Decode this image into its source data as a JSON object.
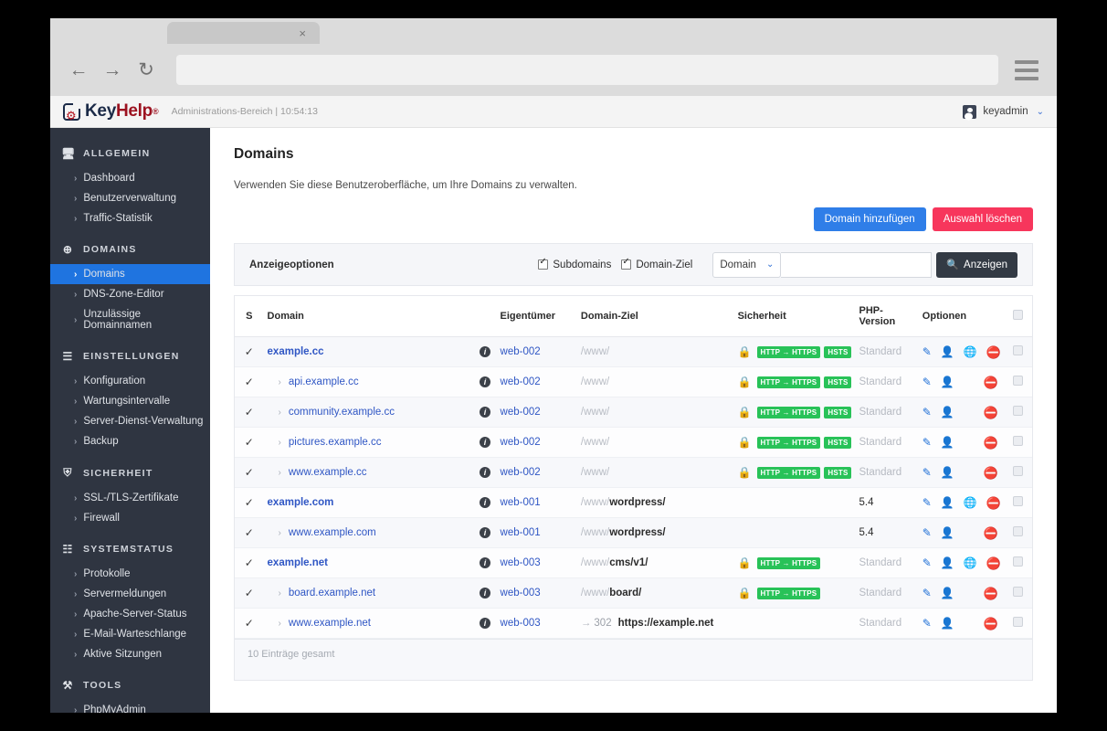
{
  "browser": {
    "tab_close": "×",
    "back_icon": "←",
    "forward_icon": "→",
    "reload_icon": "↻",
    "url_value": "",
    "url_placeholder": ""
  },
  "app_header": {
    "logo_key": "Key",
    "logo_help": "Help",
    "logo_reg": "®",
    "subtitle": "Administrations-Bereich | 10:54:13",
    "user_name": "keyadmin",
    "user_caret": "⌄"
  },
  "sidebar": {
    "groups": [
      {
        "title": "ALLGEMEIN",
        "icon": "🖥",
        "items": [
          {
            "label": "Dashboard",
            "active": false
          },
          {
            "label": "Benutzerverwaltung",
            "active": false
          },
          {
            "label": "Traffic-Statistik",
            "active": false
          }
        ]
      },
      {
        "title": "DOMAINS",
        "icon": "⊕",
        "items": [
          {
            "label": "Domains",
            "active": true
          },
          {
            "label": "DNS-Zone-Editor",
            "active": false
          },
          {
            "label": "Unzulässige Domainnamen",
            "active": false
          }
        ]
      },
      {
        "title": "EINSTELLUNGEN",
        "icon": "☰",
        "items": [
          {
            "label": "Konfiguration",
            "active": false
          },
          {
            "label": "Wartungsintervalle",
            "active": false
          },
          {
            "label": "Server-Dienst-Verwaltung",
            "active": false
          },
          {
            "label": "Backup",
            "active": false
          }
        ]
      },
      {
        "title": "SICHERHEIT",
        "icon": "⛨",
        "items": [
          {
            "label": "SSL-/TLS-Zertifikate",
            "active": false
          },
          {
            "label": "Firewall",
            "active": false
          }
        ]
      },
      {
        "title": "SYSTEMSTATUS",
        "icon": "☷",
        "items": [
          {
            "label": "Protokolle",
            "active": false
          },
          {
            "label": "Servermeldungen",
            "active": false
          },
          {
            "label": "Apache-Server-Status",
            "active": false
          },
          {
            "label": "E-Mail-Warteschlange",
            "active": false
          },
          {
            "label": "Aktive Sitzungen",
            "active": false
          }
        ]
      },
      {
        "title": "TOOLS",
        "icon": "⚒",
        "items": [
          {
            "label": "PhpMyAdmin",
            "active": false
          }
        ]
      }
    ],
    "chevron": "›",
    "active_color": "#1f74e0"
  },
  "page": {
    "title": "Domains",
    "description": "Verwenden Sie diese Benutzeroberfläche, um Ihre Domains zu verwalten.",
    "add_button": "Domain hinzufügen",
    "delete_button": "Auswahl löschen",
    "add_button_color": "#2f7ee8",
    "delete_button_color": "#f7365c"
  },
  "filter": {
    "label": "Anzeigeoptionen",
    "checkbox_subdomains": "Subdomains",
    "checkbox_subdomains_checked": true,
    "checkbox_domainziel": "Domain-Ziel",
    "checkbox_domainziel_checked": true,
    "select_value": "Domain",
    "select_caret": "⌄",
    "input_value": "",
    "input_placeholder": "",
    "submit_label": "Anzeigen",
    "submit_icon": "🔍"
  },
  "table": {
    "headers": [
      "S",
      "Domain",
      "",
      "Eigentümer",
      "Domain-Ziel",
      "Sicherheit",
      "PHP-Version",
      "Optionen",
      ""
    ],
    "check_mark": "✓",
    "info_icon": "i",
    "sub_chevron": "›",
    "rows": [
      {
        "domain": "example.cc",
        "sub": false,
        "owner": "web-002",
        "target_grey": "/www/",
        "target_dark": "",
        "lock": "orange",
        "badges": [
          "HTTP → HTTPS",
          "HSTS"
        ],
        "php": "Standard",
        "php_muted": true,
        "globe": "blue"
      },
      {
        "domain": "api.example.cc",
        "sub": true,
        "owner": "web-002",
        "target_grey": "/www/",
        "target_dark": "",
        "lock": "orange",
        "badges": [
          "HTTP → HTTPS",
          "HSTS"
        ],
        "php": "Standard",
        "php_muted": true,
        "globe": "none"
      },
      {
        "domain": "community.example.cc",
        "sub": true,
        "owner": "web-002",
        "target_grey": "/www/",
        "target_dark": "",
        "lock": "orange",
        "badges": [
          "HTTP → HTTPS",
          "HSTS"
        ],
        "php": "Standard",
        "php_muted": true,
        "globe": "none"
      },
      {
        "domain": "pictures.example.cc",
        "sub": true,
        "owner": "web-002",
        "target_grey": "/www/",
        "target_dark": "",
        "lock": "orange",
        "badges": [
          "HTTP → HTTPS",
          "HSTS"
        ],
        "php": "Standard",
        "php_muted": true,
        "globe": "none"
      },
      {
        "domain": "www.example.cc",
        "sub": true,
        "owner": "web-002",
        "target_grey": "/www/",
        "target_dark": "",
        "lock": "orange",
        "badges": [
          "HTTP → HTTPS",
          "HSTS"
        ],
        "php": "Standard",
        "php_muted": true,
        "globe": "none"
      },
      {
        "domain": "example.com",
        "sub": false,
        "owner": "web-001",
        "target_grey": "/www/",
        "target_dark": "wordpress/",
        "lock": "none",
        "badges": [],
        "php": "5.4",
        "php_muted": false,
        "globe": "grey"
      },
      {
        "domain": "www.example.com",
        "sub": true,
        "owner": "web-001",
        "target_grey": "/www/",
        "target_dark": "wordpress/",
        "lock": "none",
        "badges": [],
        "php": "5.4",
        "php_muted": false,
        "globe": "none"
      },
      {
        "domain": "example.net",
        "sub": false,
        "owner": "web-003",
        "target_grey": "/www/",
        "target_dark": "cms/v1/",
        "lock": "blue",
        "badges": [
          "HTTP → HTTPS"
        ],
        "php": "Standard",
        "php_muted": true,
        "globe": "grey"
      },
      {
        "domain": "board.example.net",
        "sub": true,
        "owner": "web-003",
        "target_grey": "/www/",
        "target_dark": "board/",
        "lock": "blue",
        "badges": [
          "HTTP → HTTPS"
        ],
        "php": "Standard",
        "php_muted": true,
        "globe": "none"
      },
      {
        "domain": "www.example.net",
        "sub": true,
        "owner": "web-003",
        "redirect_arrow": "→",
        "redirect_code": "302",
        "redirect_url": "https://example.net",
        "target_grey": "",
        "target_dark": "",
        "lock": "none",
        "badges": [],
        "php": "Standard",
        "php_muted": true,
        "globe": "none"
      }
    ],
    "footer": "10 Einträge gesamt",
    "badge_color": "#28c258"
  }
}
